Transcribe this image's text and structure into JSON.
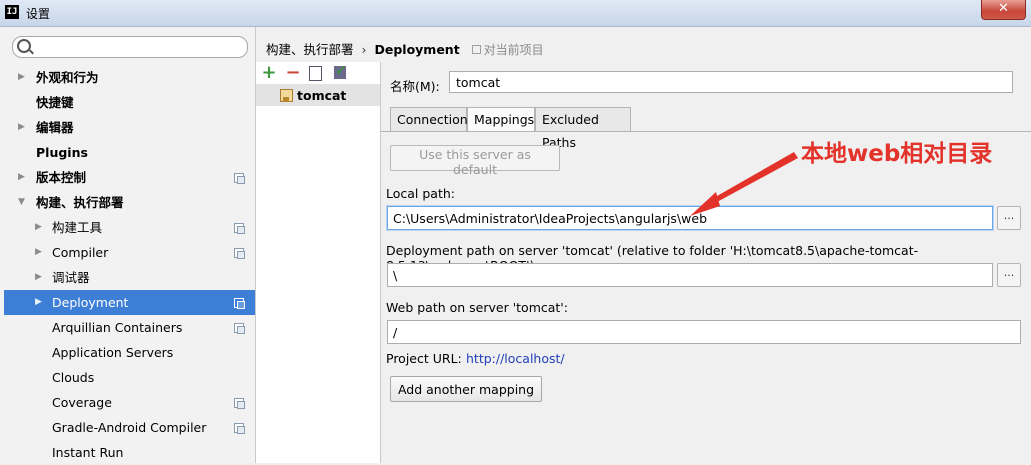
{
  "window": {
    "title": "设置",
    "app_icon_text": "IJ",
    "close_label": "✕"
  },
  "sidebar": {
    "search": {
      "value": "",
      "placeholder": ""
    },
    "items": [
      {
        "label": "外观和行为",
        "expandable": true,
        "bold": true,
        "project_icon": false
      },
      {
        "label": "快捷键",
        "expandable": false,
        "bold": true,
        "project_icon": false
      },
      {
        "label": "编辑器",
        "expandable": true,
        "bold": true,
        "project_icon": false
      },
      {
        "label": "Plugins",
        "expandable": false,
        "bold": true,
        "project_icon": false
      },
      {
        "label": "版本控制",
        "expandable": true,
        "bold": true,
        "project_icon": true
      },
      {
        "label": "构建、执行部署",
        "expandable": true,
        "expanded": true,
        "bold": true,
        "project_icon": false
      },
      {
        "label": "构建工具",
        "expandable": true,
        "bold": false,
        "project_icon": true
      },
      {
        "label": "Compiler",
        "expandable": true,
        "bold": false,
        "project_icon": true
      },
      {
        "label": "调试器",
        "expandable": true,
        "bold": false,
        "project_icon": false
      },
      {
        "label": "Deployment",
        "expandable": true,
        "bold": false,
        "project_icon": true,
        "selected": true
      },
      {
        "label": "Arquillian Containers",
        "expandable": false,
        "bold": false,
        "project_icon": true
      },
      {
        "label": "Application Servers",
        "expandable": false,
        "bold": false,
        "project_icon": false
      },
      {
        "label": "Clouds",
        "expandable": false,
        "bold": false,
        "project_icon": false
      },
      {
        "label": "Coverage",
        "expandable": false,
        "bold": false,
        "project_icon": true
      },
      {
        "label": "Gradle-Android Compiler",
        "expandable": false,
        "bold": false,
        "project_icon": true
      },
      {
        "label": "Instant Run",
        "expandable": false,
        "bold": false,
        "project_icon": false
      }
    ]
  },
  "breadcrumb": {
    "parent": "构建、执行部署",
    "separator": "›",
    "current": "Deployment",
    "scope": "对当前项目"
  },
  "servers": {
    "toolbar": {
      "add": "+",
      "remove": "−"
    },
    "items": [
      {
        "name": "tomcat"
      }
    ]
  },
  "form": {
    "name_label": "名称(M):",
    "name_value": "tomcat",
    "tabs": [
      {
        "label": "Connection",
        "active": false
      },
      {
        "label": "Mappings",
        "active": true
      },
      {
        "label": "Excluded Paths",
        "active": false
      }
    ],
    "default_button": "Use this server as default",
    "local_path_label": "Local path:",
    "local_path_value": "C:\\Users\\Administrator\\IdeaProjects\\angularjs\\web",
    "deployment_path_label": "Deployment path on server 'tomcat' (relative to folder 'H:\\tomcat8.5\\apache-tomcat-8.5.13\\webapps\\ROOT'):",
    "deployment_path_value": "\\",
    "web_path_label": "Web path on server 'tomcat':",
    "web_path_value": "/",
    "project_url_label": "Project URL:",
    "project_url_value": "http://localhost/",
    "add_mapping_button": "Add another mapping",
    "browse_label": "..."
  },
  "annotation": {
    "text": "本地web相对目录",
    "color": "#e3322a"
  },
  "colors": {
    "selection": "#3d7fd6",
    "link": "#2140b8"
  }
}
